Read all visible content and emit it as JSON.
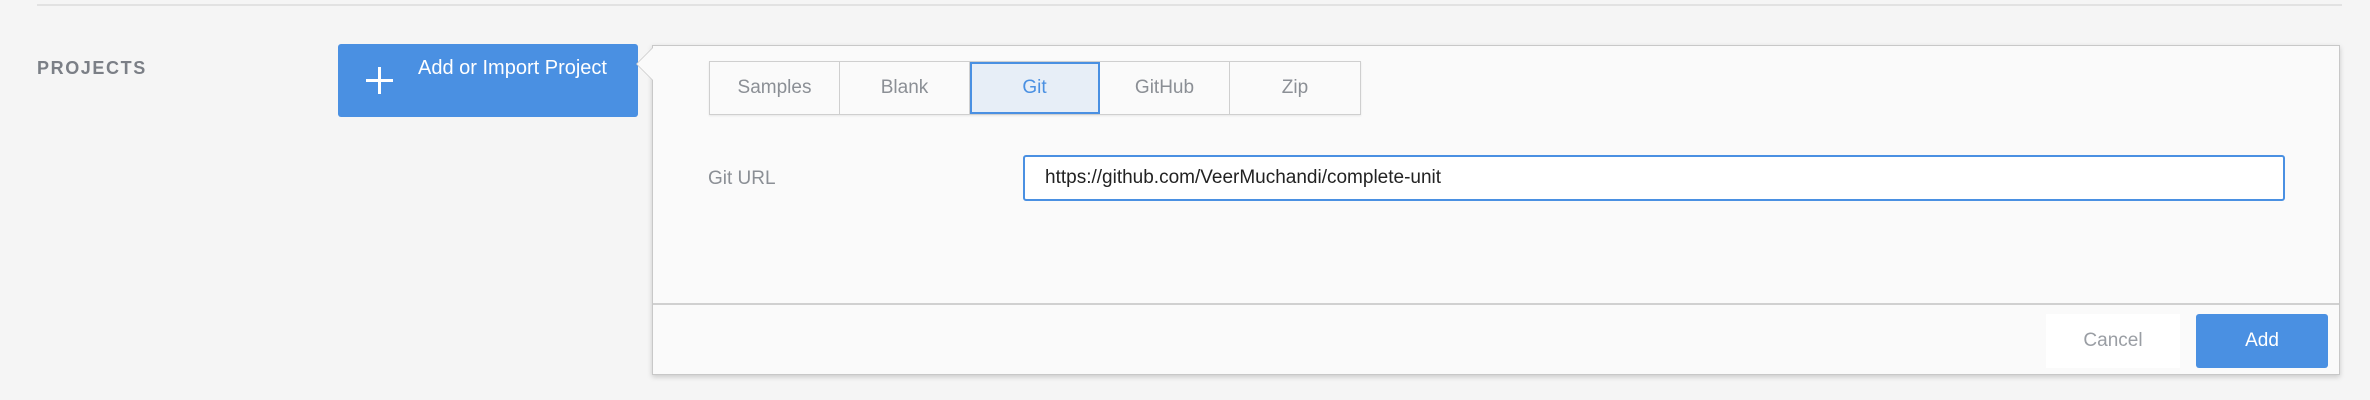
{
  "section": {
    "label": "PROJECTS"
  },
  "add_import_button": {
    "label": "Add or Import Project",
    "icon": "plus-icon"
  },
  "panel": {
    "tabs": [
      {
        "label": "Samples",
        "active": false
      },
      {
        "label": "Blank",
        "active": false
      },
      {
        "label": "Git",
        "active": true
      },
      {
        "label": "GitHub",
        "active": false
      },
      {
        "label": "Zip",
        "active": false
      }
    ],
    "git_url": {
      "label": "Git URL",
      "value": "https://github.com/VeerMuchandi/complete-unit"
    },
    "cancel_label": "Cancel",
    "add_label": "Add"
  },
  "colors": {
    "accent": "#4a90e2",
    "background": "#f5f5f5",
    "panel_background": "#fafafa"
  }
}
